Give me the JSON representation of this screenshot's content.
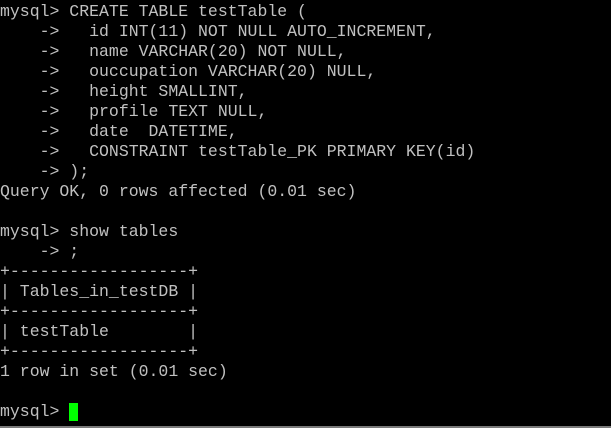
{
  "terminal": {
    "lines": [
      "mysql> CREATE TABLE testTable (",
      "    ->   id INT(11) NOT NULL AUTO_INCREMENT,",
      "    ->   name VARCHAR(20) NOT NULL,",
      "    ->   ouccupation VARCHAR(20) NULL,",
      "    ->   height SMALLINT,",
      "    ->   profile TEXT NULL,",
      "    ->   date  DATETIME,",
      "    ->   CONSTRAINT testTable_PK PRIMARY KEY(id)",
      "    -> );",
      "Query OK, 0 rows affected (0.01 sec)",
      "",
      "mysql> show tables",
      "    -> ;",
      "+------------------+",
      "| Tables_in_testDB |",
      "+------------------+",
      "| testTable        |",
      "+------------------+",
      "1 row in set (0.01 sec)",
      "",
      "mysql> "
    ],
    "cursor_color": "#00ff00",
    "text_color": "#c0c0c0",
    "background_color": "#000000"
  }
}
